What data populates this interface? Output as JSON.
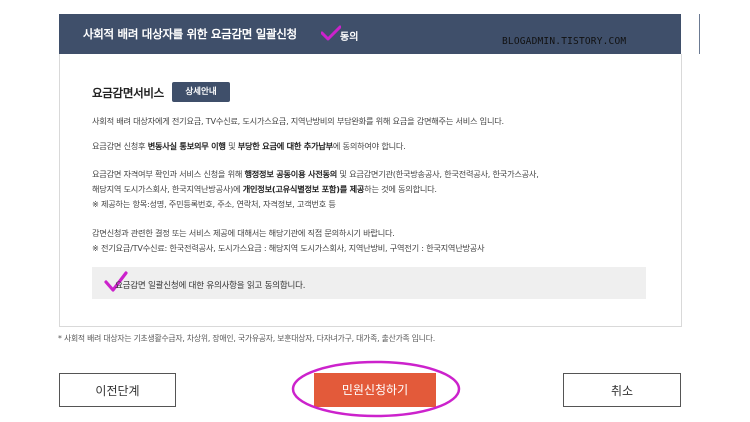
{
  "header": {
    "title": "사회적 배려 대상자를 위한 요금감면 일괄신청",
    "agree_label": "동의"
  },
  "watermark": "BLOGADMIN.TISTORY.COM",
  "service": {
    "title": "요금감면서비스",
    "detail_button": "상세안내",
    "line1": "사회적 배려 대상자에게 전기요금, TV수신료, 도시가스요금, 지역난방비의 부담완화를 위해 요금을 감면해주는 서비스 입니다.",
    "line2_a": "요금감면 신청후 ",
    "line2_b": "변동사실 통보의무 이행",
    "line2_c": " 및 ",
    "line2_d": "부당한 요금에 대한 추가납부",
    "line2_e": "에 동의하여야 합니다.",
    "line3_a": "요금감면 자격여부 확인과 서비스 신청을 위해 ",
    "line3_b": "행정정보 공동이용 사전동의",
    "line3_c": " 및 요금감면기관(한국방송공사, 한국전력공사, 한국가스공사,",
    "line4_a": "해당지역 도시가스회사, 한국지역난방공사)에 ",
    "line4_b": "개인정보(고유식별정보 포함)를 제공",
    "line4_c": "하는 것에 동의합니다.",
    "line5": "※ 제공하는 항목:성명, 주민등록번호, 주소, 연락처, 자격정보, 고객번호 등",
    "line6": "감면신청과 관련한 결정 또는 서비스 제공에 대해서는 해당기관에 직접 문의하시기 바랍니다.",
    "line7": "※ 전기요금/TV수신료: 한국전력공사, 도시가스요금 : 해당지역 도시가스회사, 지역난방비, 구역전기 : 한국지역난방공사",
    "consent": "요금감면 일괄신청에 대한 유의사항을 읽고 동의합니다."
  },
  "footnote": "* 사회적 배려 대상자는 기초생활수급자, 차상위, 장애인, 국가유공자, 보훈대상자, 다자녀가구, 대가족, 출산가족 입니다.",
  "buttons": {
    "prev": "이전단계",
    "submit": "민원신청하기",
    "cancel": "취소"
  },
  "colors": {
    "header_bg": "#3f4f6a",
    "submit_bg": "#e35a3a",
    "annotation": "#cc22cc"
  }
}
